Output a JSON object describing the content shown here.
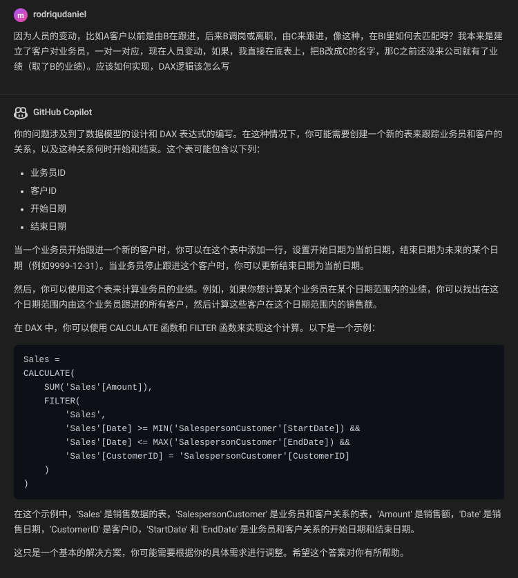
{
  "user_message": {
    "username": "rodriqudaniel",
    "avatar_letter": "m",
    "content": "因为人员的变动，比如A客户以前是由B在跟进，后来B调岗或离职，由C来跟进，像这种，在BI里如何去匹配呀？我本来是建立了客户对业务员，一对一对应，现在人员变动，如果，我直接在底表上，把B改成C的名字，那C之前还没来公司就有了业绩（取了B的业绩）。应该如何实现，DAX逻辑该怎么写"
  },
  "copilot_message": {
    "username": "GitHub Copilot",
    "intro": "你的问题涉及到了数据模型的设计和 DAX 表达式的编写。在这种情况下，你可能需要创建一个新的表来跟踪业务员和客户的关系，以及这种关系何时开始和结束。这个表可能包含以下列：",
    "list_items": [
      "业务员ID",
      "客户ID",
      "开始日期",
      "结束日期"
    ],
    "para1": "当一个业务员开始跟进一个新的客户时，你可以在这个表中添加一行，设置开始日期为当前日期，结束日期为未来的某个日期（例如9999-12-31）。当业务员停止跟进这个客户时，你可以更新结束日期为当前日期。",
    "para2": "然后，你可以使用这个表来计算业务员的业绩。例如，如果你想计算某个业务员在某个日期范围内的业绩，你可以找出在这个日期范围内由这个业务员跟进的所有客户，然后计算这些客户在这个日期范围内的销售额。",
    "para3": "在 DAX 中，你可以使用 CALCULATE 函数和 FILTER 函数来实现这个计算。以下是一个示例：",
    "code": "Sales =\nCALCULATE(\n    SUM('Sales'[Amount]),\n    FILTER(\n        'Sales',\n        'Sales'[Date] >= MIN('SalespersonCustomer'[StartDate]) &&\n        'Sales'[Date] <= MAX('SalespersonCustomer'[EndDate]) &&\n        'Sales'[CustomerID] = 'SalespersonCustomer'[CustomerID]\n    )\n)",
    "para4": "在这个示例中，'Sales' 是销售数据的表，'SalespersonCustomer' 是业务员和客户关系的表，'Amount' 是销售额，'Date' 是销售日期，'CustomerID' 是客户ID，'StartDate' 和 'EndDate' 是业务员和客户关系的开始日期和结束日期。",
    "para5": "这只是一个基本的解决方案，你可能需要根据你的具体需求进行调整。希望这个答案对你有所帮助。"
  }
}
